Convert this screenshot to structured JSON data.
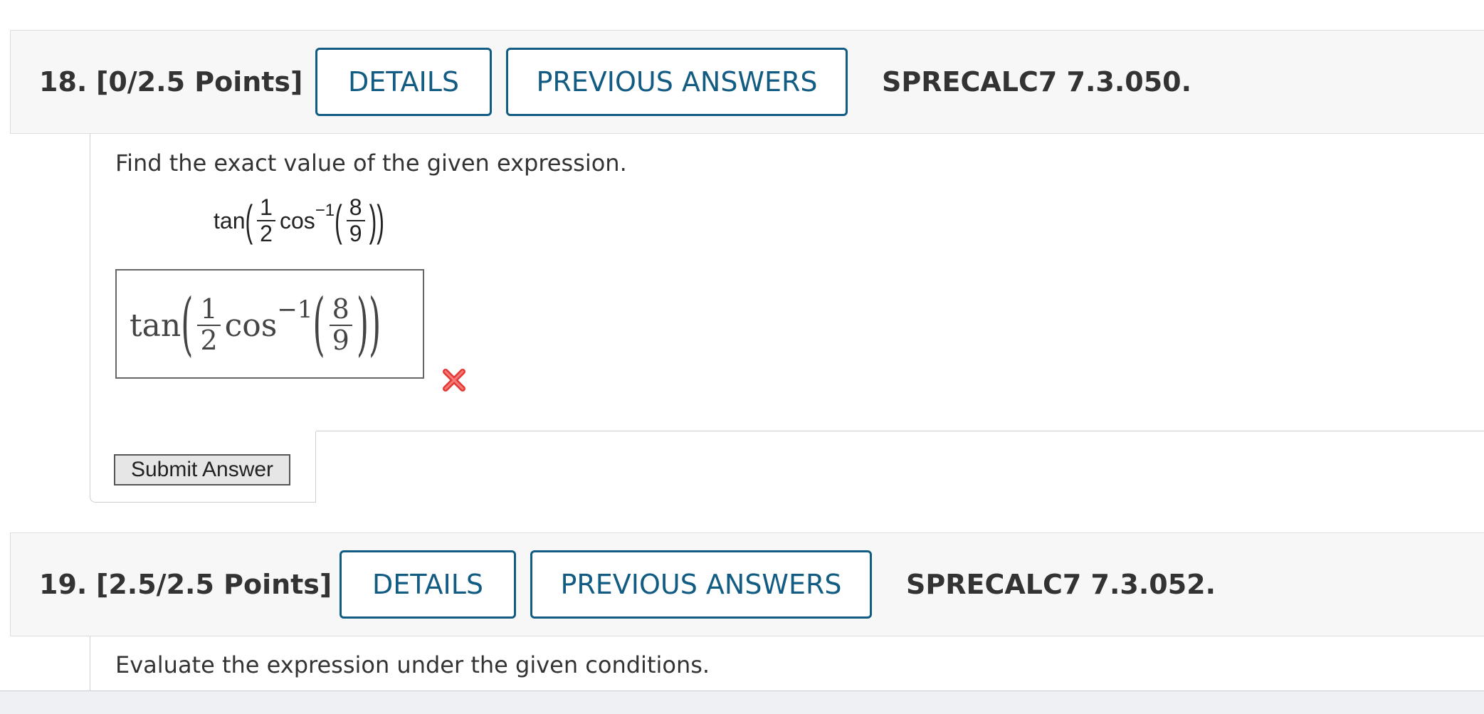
{
  "questions": [
    {
      "number": "18.",
      "points": "[0/2.5 Points]",
      "details_label": "DETAILS",
      "previous_label": "PREVIOUS ANSWERS",
      "code": "SPRECALC7 7.3.050.",
      "prompt": "Find the exact value of the given expression.",
      "expression": {
        "fn": "tan",
        "half_num": "1",
        "half_den": "2",
        "inner_fn": "cos",
        "exponent": "−1",
        "arg_num": "8",
        "arg_den": "9"
      },
      "answer": {
        "fn": "tan",
        "half_num": "1",
        "half_den": "2",
        "inner_fn": "cos",
        "exponent": "−1",
        "arg_num": "8",
        "arg_den": "9",
        "status": "incorrect"
      },
      "submit_label": "Submit Answer"
    },
    {
      "number": "19.",
      "points": "[2.5/2.5 Points]",
      "details_label": "DETAILS",
      "previous_label": "PREVIOUS ANSWERS",
      "code": "SPRECALC7 7.3.052.",
      "prompt": "Evaluate the expression under the given conditions."
    }
  ],
  "colors": {
    "accent": "#125b82",
    "header_bg": "#f7f7f7",
    "wrong": "#e53935"
  }
}
